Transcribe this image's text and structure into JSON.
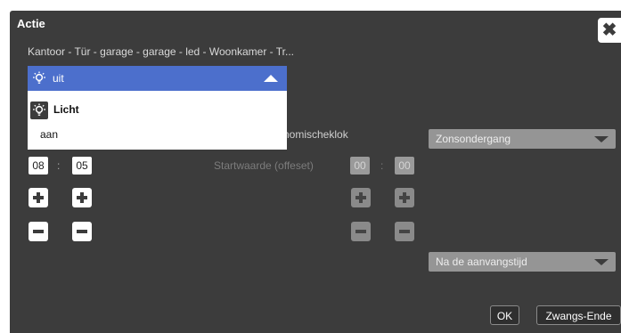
{
  "dialog": {
    "title": "Actie",
    "close_icon": "close-icon",
    "subtitle": "Kantoor - Tür - garage - garage - led - Woonkamer - Tr...",
    "astro_label": "nomischeklok",
    "dropdown": {
      "selected": "uit",
      "icon": "light-bulb-icon",
      "options": [
        {
          "label": "Licht",
          "type": "group-header",
          "icon": "light-bulb-icon"
        },
        {
          "label": "aan"
        }
      ]
    },
    "zon_select": "Zonsondergang",
    "na_select": "Na de aanvangstijd",
    "time": {
      "hours": "08",
      "minutes": "05",
      "separator": ":"
    },
    "offset": {
      "label": "Startwaarde (offeset)",
      "hours": "00",
      "minutes": "00",
      "separator": ":",
      "enabled": false
    },
    "buttons": {
      "ok": "OK",
      "force_end": "Zwangs-Ende"
    }
  },
  "colors": {
    "dialog_bg": "#3c3c3c",
    "dropdown_accent": "#4c6fcc",
    "select_bg": "#959595"
  }
}
